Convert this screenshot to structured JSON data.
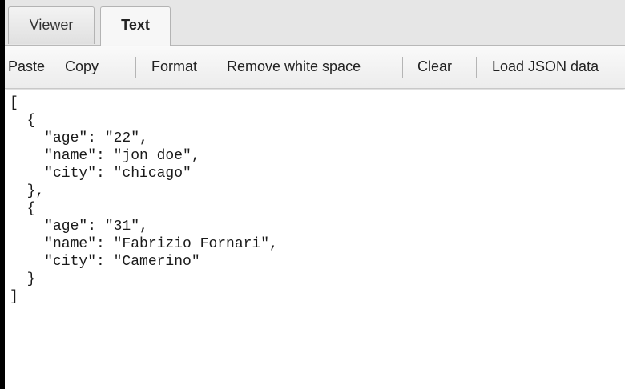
{
  "tabs": {
    "viewer_label": "Viewer",
    "text_label": "Text",
    "active": "Text"
  },
  "toolbar": {
    "paste_label": "Paste",
    "copy_label": "Copy",
    "format_label": "Format",
    "remove_whitespace_label": "Remove white space",
    "clear_label": "Clear",
    "load_json_label": "Load JSON data"
  },
  "editor": {
    "lines": [
      "[",
      "  {",
      "    \"age\": \"22\",",
      "    \"name\": \"jon doe\",",
      "    \"city\": \"chicago\"",
      "  },",
      "  {",
      "    \"age\": \"31\",",
      "    \"name\": \"Fabrizio Fornari\",",
      "    \"city\": \"Camerino\"",
      "  }",
      "]"
    ]
  }
}
